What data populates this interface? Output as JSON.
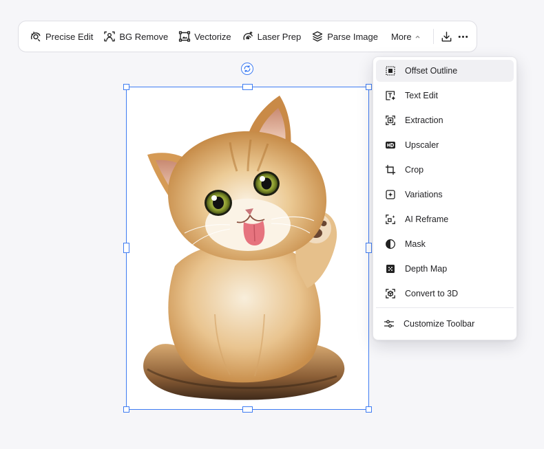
{
  "toolbar": {
    "precise_edit": "Precise Edit",
    "bg_remove": "BG Remove",
    "vectorize": "Vectorize",
    "laser_prep": "Laser Prep",
    "parse_image": "Parse Image",
    "more": "More"
  },
  "menu": {
    "items": [
      {
        "label": "Offset Outline",
        "icon": "offset-outline-icon"
      },
      {
        "label": "Text Edit",
        "icon": "text-edit-icon"
      },
      {
        "label": "Extraction",
        "icon": "extraction-icon"
      },
      {
        "label": "Upscaler",
        "icon": "hd-icon"
      },
      {
        "label": "Crop",
        "icon": "crop-icon"
      },
      {
        "label": "Variations",
        "icon": "variations-icon"
      },
      {
        "label": "AI Reframe",
        "icon": "reframe-icon"
      },
      {
        "label": "Mask",
        "icon": "mask-icon"
      },
      {
        "label": "Depth Map",
        "icon": "depth-map-icon"
      },
      {
        "label": "Convert to 3D",
        "icon": "convert-3d-icon"
      }
    ],
    "customize": "Customize Toolbar"
  },
  "colors": {
    "accent": "#3d7bf2",
    "background": "#f6f6f9",
    "menu_active": "#f0f0f3"
  }
}
